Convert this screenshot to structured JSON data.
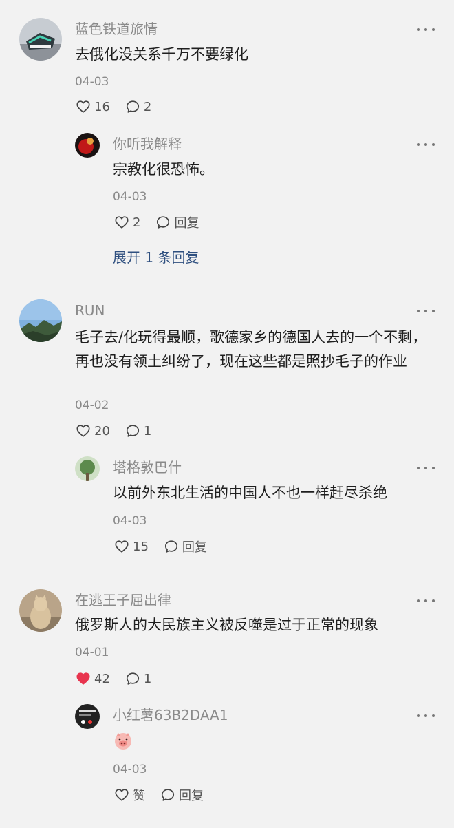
{
  "comments": [
    {
      "user": "蓝色铁道旅情",
      "text": "去俄化没关系千万不要绿化",
      "date": "04-03",
      "likes": "16",
      "replies": "2",
      "reply": {
        "user": "你听我解释",
        "text": "宗教化很恐怖。",
        "date": "04-03",
        "likes": "2",
        "reply_label": "回复"
      },
      "expand_label": "展开 1 条回复"
    },
    {
      "user": "RUN",
      "text": "毛子去/化玩得最顺，歌德家乡的德国人去的一个不剩，再也没有领土纠纷了，现在这些都是照抄毛子的作业",
      "date": "04-02",
      "likes": "20",
      "replies": "1",
      "reply": {
        "user": "塔格敦巴什",
        "text": "以前外东北生活的中国人不也一样赶尽杀绝",
        "date": "04-03",
        "likes": "15",
        "reply_label": "回复"
      }
    },
    {
      "user": "在逃王子屈出律",
      "text": "俄罗斯人的大民族主义被反噬是过于正常的现象",
      "date": "04-01",
      "likes": "42",
      "liked": true,
      "replies": "1",
      "reply": {
        "user": "小红薯63B2DAA1",
        "text": "",
        "emoji": "pig-face-emoji",
        "date": "04-03",
        "likes": "赞",
        "reply_label": "回复"
      }
    }
  ],
  "colors": {
    "background": "#f2f2f2",
    "text": "#1f1f1f",
    "muted": "#8a8a8a",
    "link": "#2e4f7f",
    "liked_heart": "#e8344e"
  }
}
